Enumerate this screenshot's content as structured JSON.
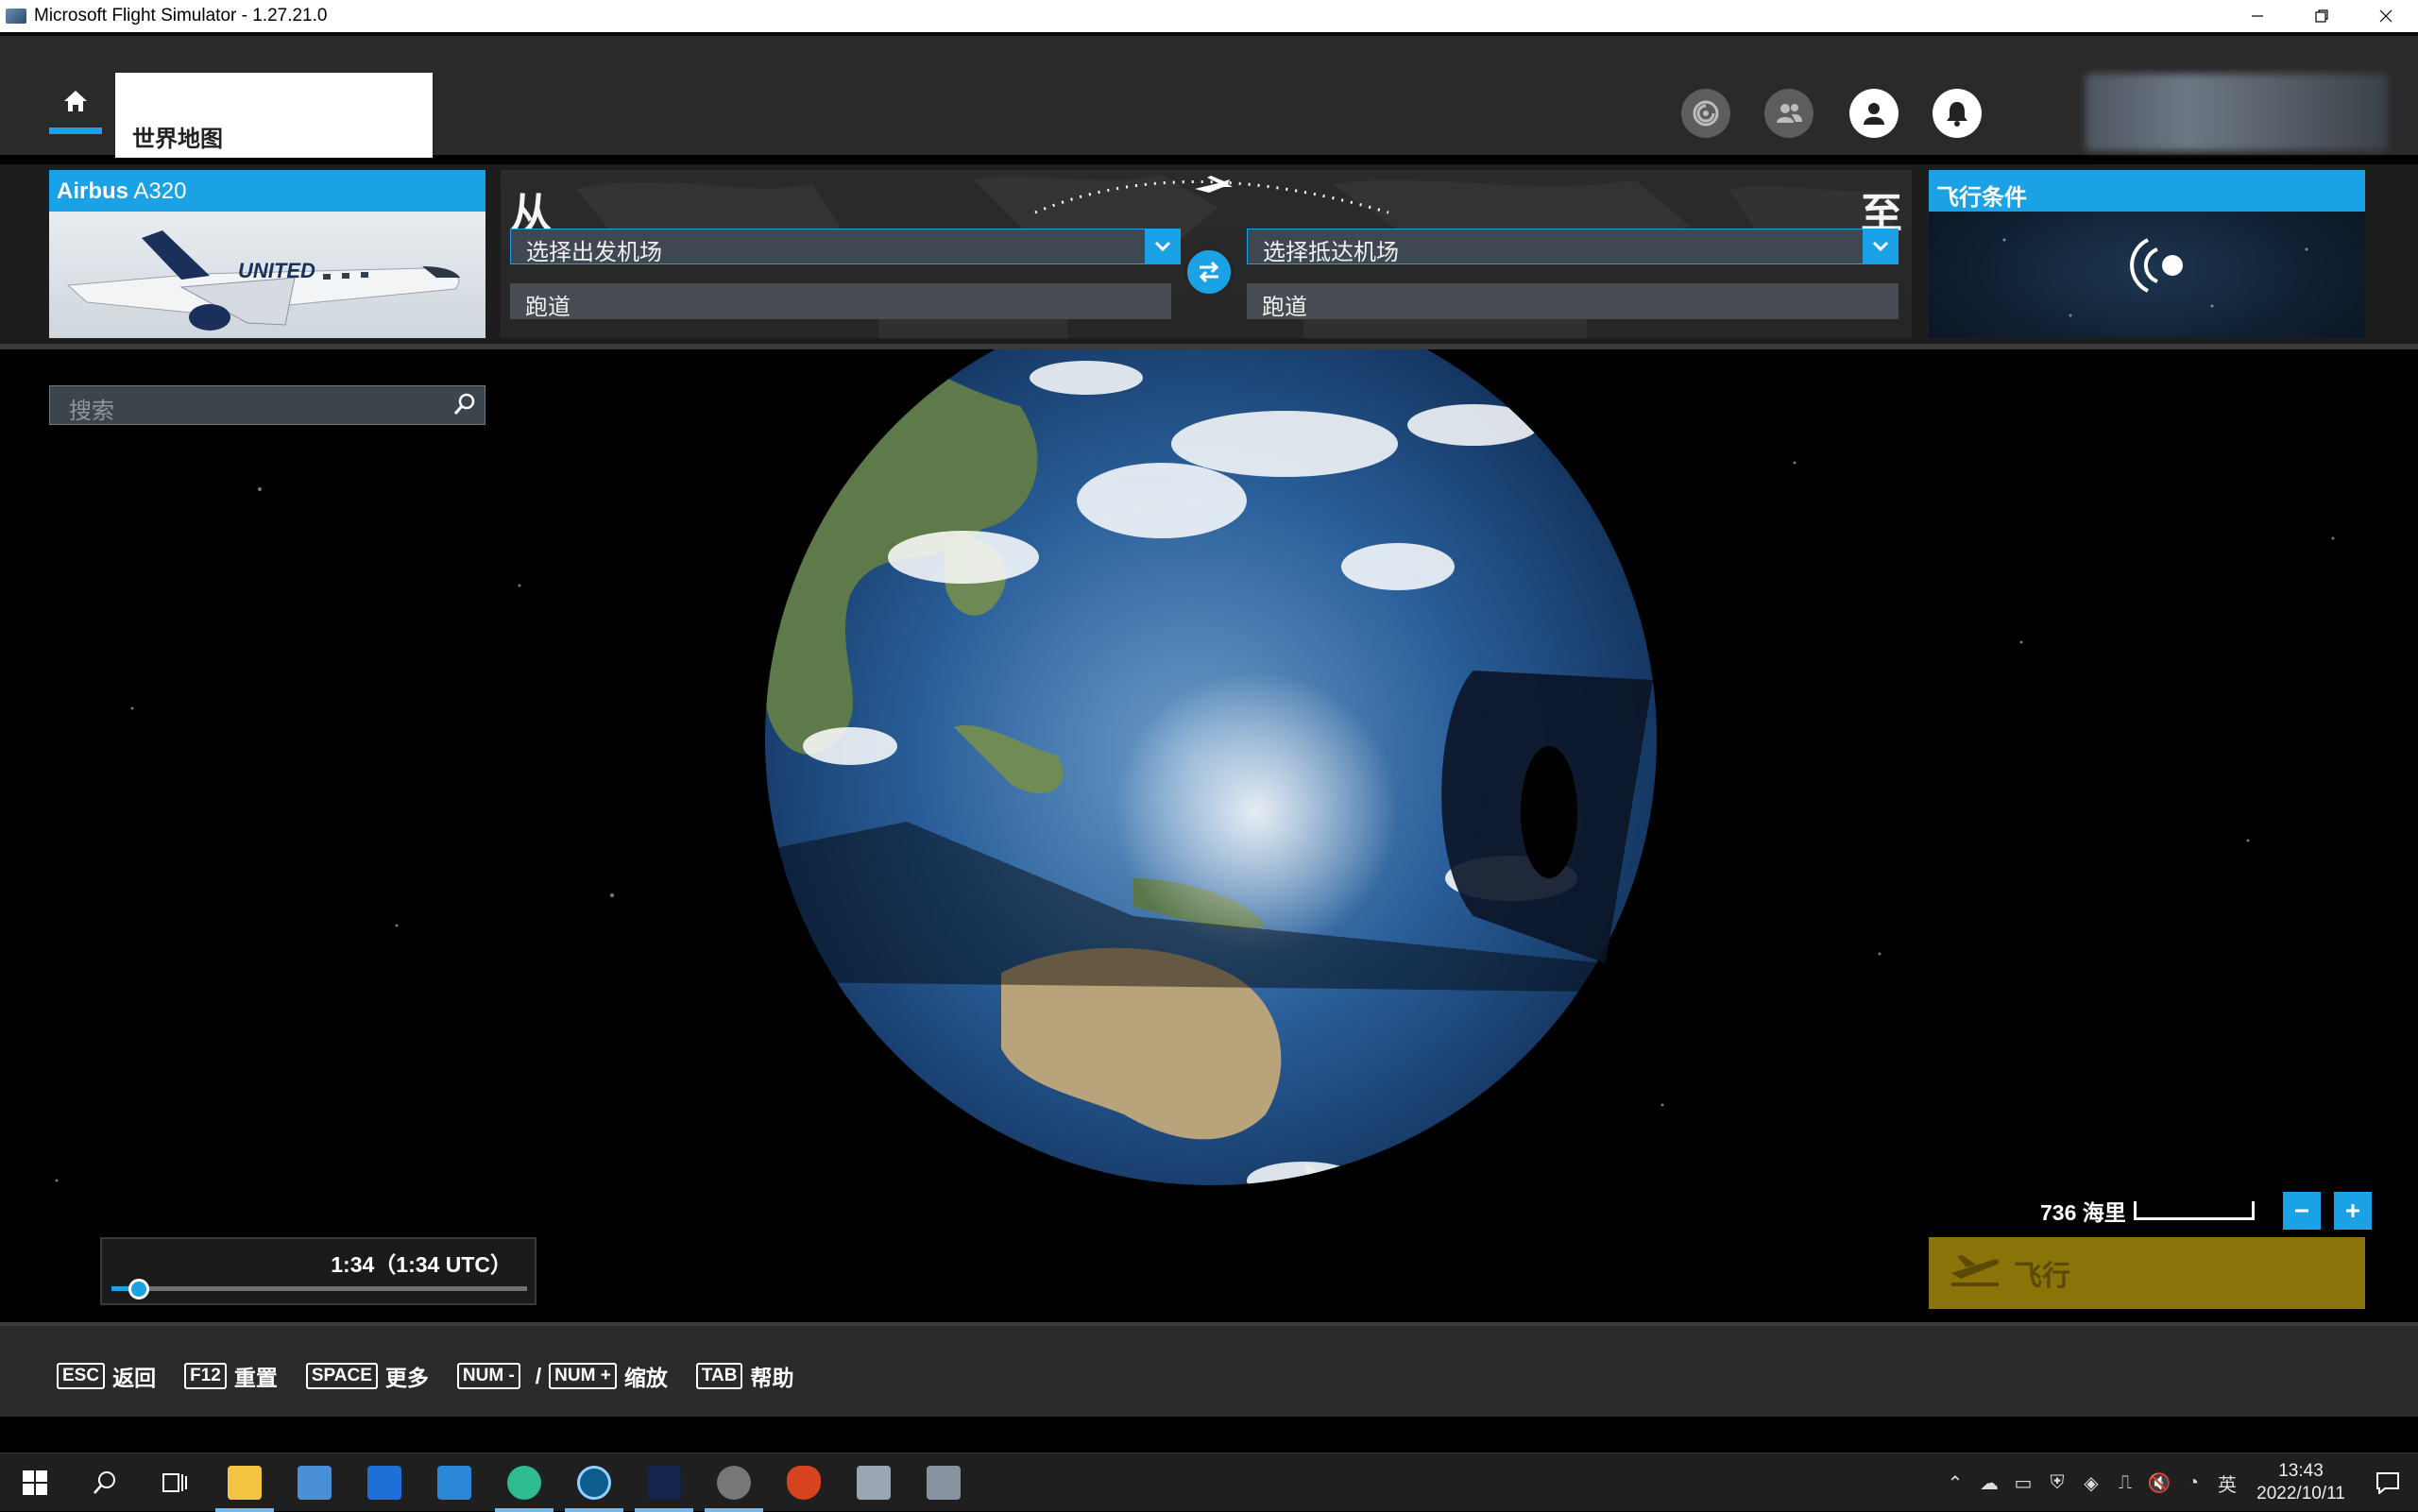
{
  "window": {
    "title": "Microsoft Flight Simulator - 1.27.21.0"
  },
  "topbar": {
    "tab_label": "世界地图",
    "icons": [
      "achievements-icon",
      "friends-icon",
      "profile-icon",
      "notifications-icon"
    ]
  },
  "aircraft": {
    "maker": "Airbus",
    "model": "A320",
    "livery_text": "UNITED"
  },
  "route": {
    "from_label": "从",
    "to_label": "至",
    "departure_placeholder": "选择出发机场",
    "arrival_placeholder": "选择抵达机场",
    "runway_label": "跑道"
  },
  "conditions": {
    "title": "飞行条件"
  },
  "map": {
    "search_placeholder": "搜索",
    "scale_label": "736 海里",
    "fly_label": "飞行",
    "time_label": "1:34（1:34 UTC）",
    "time_of_day_fraction": 0.065
  },
  "footer": {
    "hints": [
      {
        "key": "ESC",
        "label": "返回"
      },
      {
        "key": "F12",
        "label": "重置"
      },
      {
        "key": "SPACE",
        "label": "更多"
      }
    ],
    "zoom_keys": [
      "NUM -",
      "NUM +"
    ],
    "zoom_label": "缩放",
    "help_key": "TAB",
    "help_label": "帮助"
  },
  "taskbar": {
    "time": "13:43",
    "date": "2022/10/11",
    "ime": "英"
  },
  "colors": {
    "accent": "#1aa1e6",
    "fly_button": "#8a7308"
  }
}
